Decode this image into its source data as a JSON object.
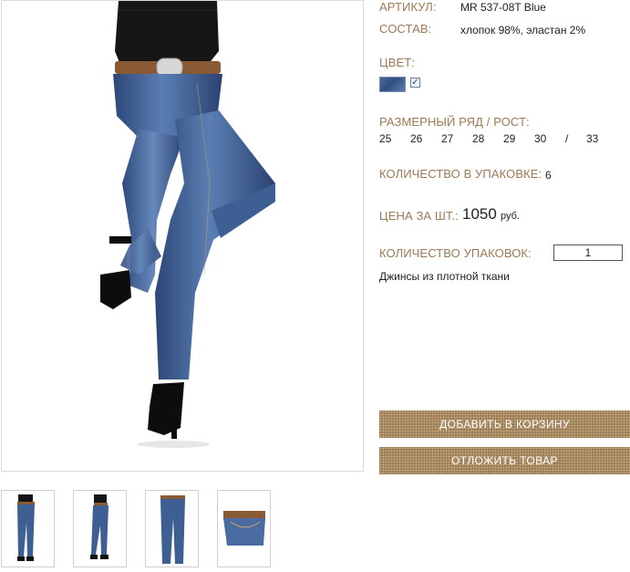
{
  "product": {
    "article_label": "АРТИКУЛ:",
    "article_value": "MR 537-08T Blue",
    "composition_label": "СОСТАВ:",
    "composition_value": "хлопок 98%, эластан 2%",
    "color_label": "ЦВЕТ:",
    "color_swatch": "#3d5f93",
    "color_checked": "✓",
    "sizes_label": "РАЗМЕРНЫЙ РЯД / РОСТ:",
    "sizes": [
      "25",
      "26",
      "27",
      "28",
      "29",
      "30",
      "/",
      "33"
    ],
    "pack_qty_label": "КОЛИЧЕСТВО В УПАКОВКЕ:",
    "pack_qty_value": "6",
    "price_label": "ЦЕНА ЗА ШТ.:",
    "price_value": "1050",
    "price_currency": "руб.",
    "packs_label": "КОЛИЧЕСТВО УПАКОВОК:",
    "packs_value": "1",
    "description": "Джинсы из плотной ткани"
  },
  "buttons": {
    "add_to_cart": "ДОБАВИТЬ В КОРЗИНУ",
    "postpone": "ОТЛОЖИТЬ ТОВАР"
  },
  "colors": {
    "label": "#9b7a55",
    "button": "#9a7a52",
    "denim": "#3d5f93"
  },
  "images": {
    "main": "jeans-model-photo",
    "thumbnails": [
      "front-view",
      "side-view",
      "flat-front",
      "waist-detail"
    ]
  }
}
